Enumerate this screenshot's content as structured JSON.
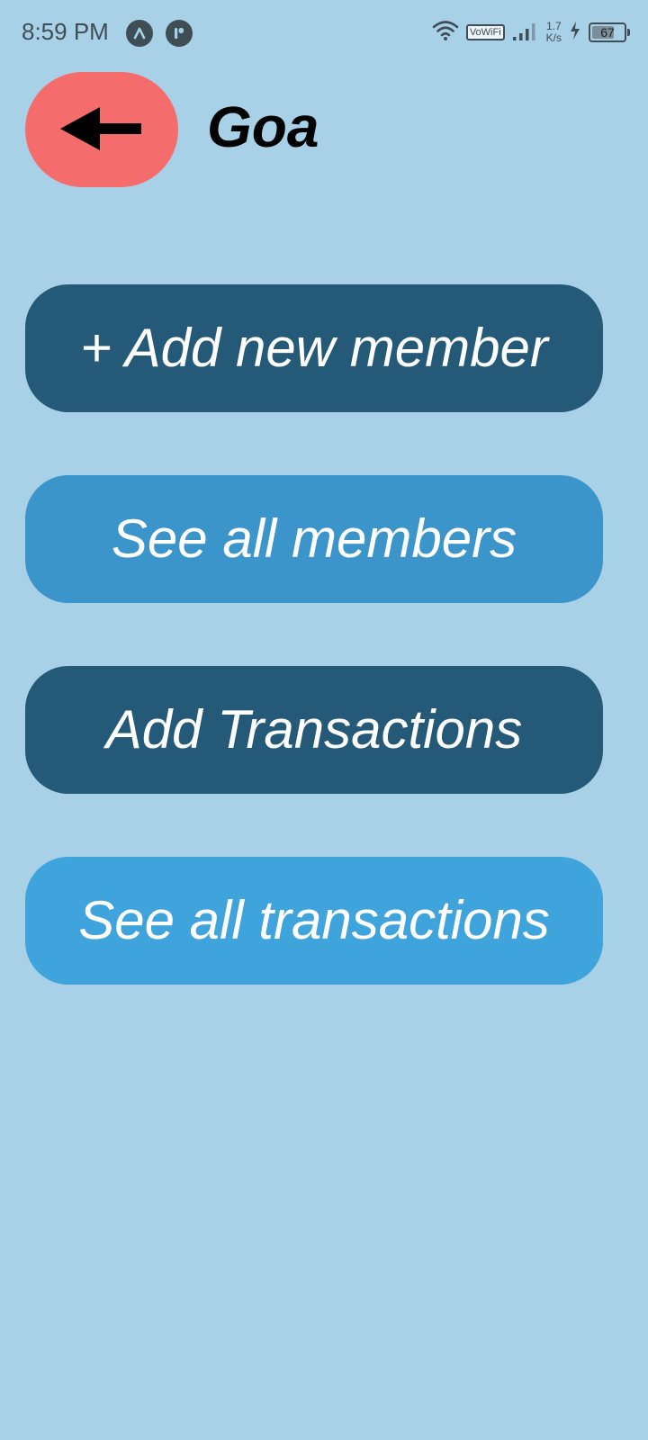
{
  "status_bar": {
    "time": "8:59 PM",
    "network_label": "VoWiFi",
    "speed_value": "1.7",
    "speed_unit": "K/s",
    "battery": "67"
  },
  "header": {
    "title": "Goa",
    "back_icon": "arrow-left-icon"
  },
  "actions": {
    "add_member": "+ Add new member",
    "see_members": "See all members",
    "add_transactions": "Add Transactions",
    "see_transactions": "See all transactions"
  },
  "colors": {
    "background": "#a8d0e6",
    "back_button": "#f56c6c",
    "dark_button": "#245a78",
    "light_button": "#3b95cb",
    "light_button_alt": "#3fa3dc"
  }
}
